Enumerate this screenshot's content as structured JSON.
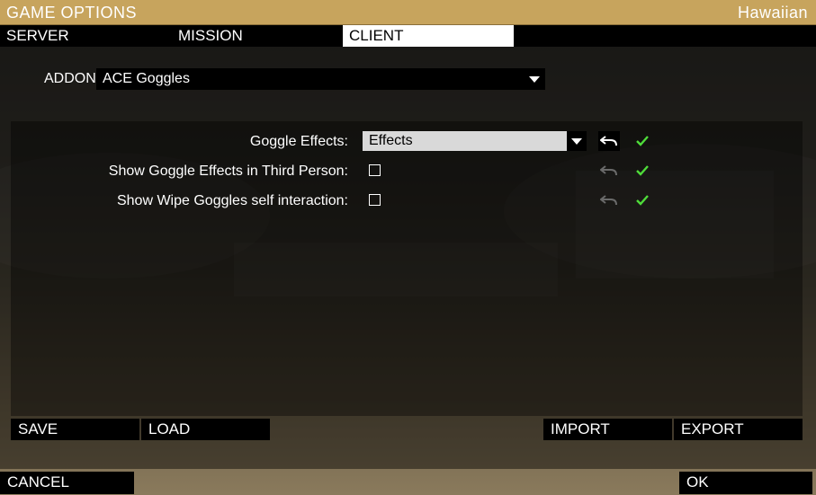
{
  "window": {
    "title": "GAME OPTIONS",
    "user": "Hawaiian"
  },
  "tabs": [
    {
      "label": "SERVER",
      "active": false
    },
    {
      "label": "MISSION",
      "active": false
    },
    {
      "label": "CLIENT",
      "active": true
    }
  ],
  "addon": {
    "label": "ADDON:",
    "value": "ACE Goggles"
  },
  "settings": [
    {
      "label": "Goggle Effects:",
      "control": "dropdown",
      "value": "Effects"
    },
    {
      "label": "Show Goggle Effects in Third Person:",
      "control": "checkbox",
      "checked": false
    },
    {
      "label": "Show Wipe Goggles self interaction:",
      "control": "checkbox",
      "checked": false
    }
  ],
  "buttons": {
    "save": "SAVE",
    "load": "LOAD",
    "import": "IMPORT",
    "export": "EXPORT",
    "cancel": "CANCEL",
    "ok": "OK"
  },
  "colors": {
    "title_bar": "#c7a45d",
    "check_green": "#4fdc3a",
    "active_tab": "#ffffff"
  },
  "icons": [
    "undo-icon",
    "check-icon",
    "chevron-down-icon"
  ]
}
